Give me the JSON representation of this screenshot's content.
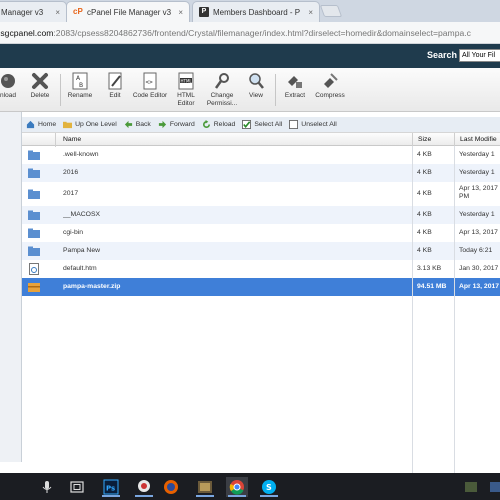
{
  "browser": {
    "tabs": [
      {
        "title": "Manager v3"
      },
      {
        "title": "cPanel File Manager v3"
      },
      {
        "title": "Members Dashboard - P"
      }
    ],
    "close_glyph": "×",
    "url_host": ".sgcpanel.com",
    "url_rest": ":2083/cpsess8204862736/frontend/Crystal/filemanager/index.html?dirselect=homedir&domainselect=pampa.c"
  },
  "header": {
    "search_label": "Search",
    "search_scope": "All Your Fil"
  },
  "toolbar": {
    "items": [
      {
        "label": "nload",
        "icon": "upload-icon"
      },
      {
        "label": "Delete",
        "icon": "delete-icon"
      },
      {
        "label": "Rename",
        "icon": "rename-icon"
      },
      {
        "label": "Edit",
        "icon": "edit-icon"
      },
      {
        "label": "Code Editor",
        "icon": "code-editor-icon"
      },
      {
        "label": "HTML Editor",
        "icon": "html-editor-icon"
      },
      {
        "label": "Change Permissi...",
        "icon": "permissions-icon"
      },
      {
        "label": "View",
        "icon": "view-icon"
      },
      {
        "label": "Extract",
        "icon": "extract-icon"
      },
      {
        "label": "Compress",
        "icon": "compress-icon"
      }
    ]
  },
  "nav": {
    "home": "Home",
    "up_one_level": "Up One Level",
    "back": "Back",
    "forward": "Forward",
    "reload": "Reload",
    "select_all": "Select All",
    "unselect_all": "Unselect All"
  },
  "table": {
    "columns": {
      "name": "Name",
      "size": "Size",
      "modified": "Last Modifie"
    },
    "rows": [
      {
        "name": ".well-known",
        "size": "4 KB",
        "modified": "Yesterday 1",
        "type": "folder"
      },
      {
        "name": "2016",
        "size": "4 KB",
        "modified": "Yesterday 1",
        "type": "folder"
      },
      {
        "name": "2017",
        "size": "4 KB",
        "modified": "Apr 13, 2017 PM",
        "type": "folder"
      },
      {
        "name": "__MACOSX",
        "size": "4 KB",
        "modified": "Yesterday 1",
        "type": "folder"
      },
      {
        "name": "cgi-bin",
        "size": "4 KB",
        "modified": "Apr 13, 2017",
        "type": "folder"
      },
      {
        "name": "Pampa New",
        "size": "4 KB",
        "modified": "Today 6:21",
        "type": "folder"
      },
      {
        "name": "default.htm",
        "size": "3.13 KB",
        "modified": "Jan 30, 2017",
        "type": "file"
      },
      {
        "name": "pampa-master.zip",
        "size": "94.51 MB",
        "modified": "Apr 13, 2017",
        "type": "zip"
      }
    ]
  },
  "colors": {
    "header_bg": "#1f3b4d",
    "selected_row": "#3f7fd8",
    "folder": "#5b8fd0",
    "taskbar": "#1b1d22"
  }
}
